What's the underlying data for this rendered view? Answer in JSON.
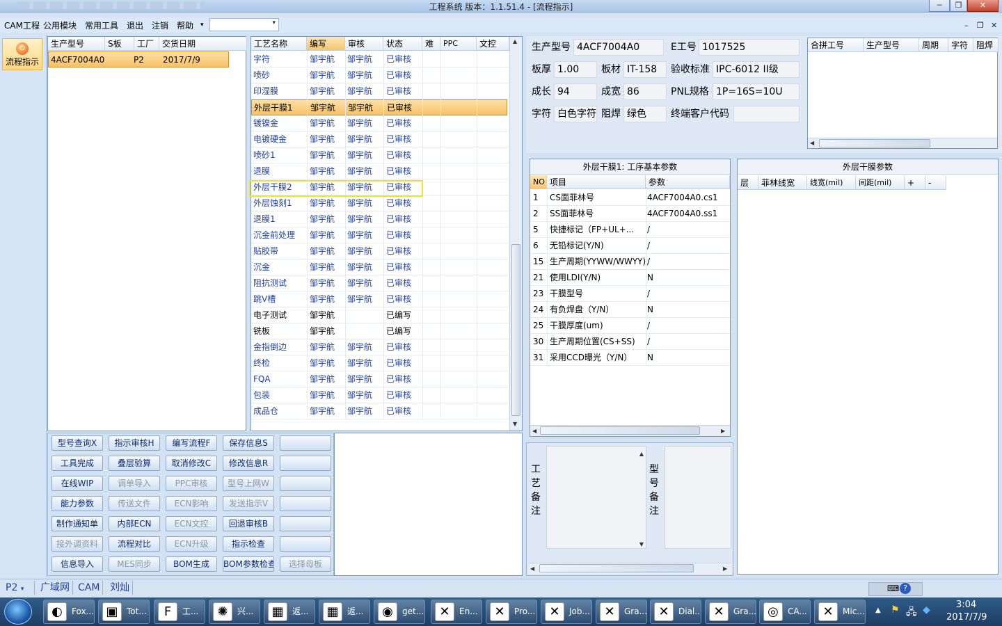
{
  "window": {
    "title": "工程系统   版本：1.1.51.4 - [流程指示]"
  },
  "menu": {
    "items": [
      "CAM工程",
      "公用模块",
      "常用工具",
      "退出",
      "注销",
      "帮助"
    ],
    "help_arrow": "▾"
  },
  "nav": {
    "flow_label": "流程指示"
  },
  "orders": {
    "headers": [
      "生产型号",
      "S板",
      "工厂",
      "交货日期"
    ],
    "rows": [
      [
        "4ACF7004A0",
        "",
        "P2",
        "2017/7/9"
      ]
    ]
  },
  "process": {
    "headers": [
      "工艺名称",
      "编写",
      "审核",
      "状态",
      "难",
      "PPC",
      "文控"
    ],
    "rows": [
      [
        "字符",
        "邹宇航",
        "邹宇航",
        "已审核"
      ],
      [
        "喷砂",
        "邹宇航",
        "邹宇航",
        "已审核"
      ],
      [
        "印湿膜",
        "邹宇航",
        "邹宇航",
        "已审核"
      ],
      [
        "外层干膜1",
        "邹宇航",
        "邹宇航",
        "已审核"
      ],
      [
        "镀镍金",
        "邹宇航",
        "邹宇航",
        "已审核"
      ],
      [
        "电镀硬金",
        "邹宇航",
        "邹宇航",
        "已审核"
      ],
      [
        "喷砂1",
        "邹宇航",
        "邹宇航",
        "已审核"
      ],
      [
        "退膜",
        "邹宇航",
        "邹宇航",
        "已审核"
      ],
      [
        "外层干膜2",
        "邹宇航",
        "邹宇航",
        "已审核"
      ],
      [
        "外层蚀刻1",
        "邹宇航",
        "邹宇航",
        "已审核"
      ],
      [
        "退膜1",
        "邹宇航",
        "邹宇航",
        "已审核"
      ],
      [
        "沉金前处理",
        "邹宇航",
        "邹宇航",
        "已审核"
      ],
      [
        "贴胶带",
        "邹宇航",
        "邹宇航",
        "已审核"
      ],
      [
        "沉金",
        "邹宇航",
        "邹宇航",
        "已审核"
      ],
      [
        "阻抗测试",
        "邹宇航",
        "邹宇航",
        "已审核"
      ],
      [
        "跳V槽",
        "邹宇航",
        "邹宇航",
        "已审核"
      ],
      [
        "电子测试",
        "邹宇航",
        "",
        "已编写"
      ],
      [
        "铣板",
        "邹宇航",
        "",
        "已编写"
      ],
      [
        "金指倒边",
        "邹宇航",
        "邹宇航",
        "已审核"
      ],
      [
        "终检",
        "邹宇航",
        "邹宇航",
        "已审核"
      ],
      [
        "FQA",
        "邹宇航",
        "邹宇航",
        "已审核"
      ],
      [
        "包装",
        "邹宇航",
        "邹宇航",
        "已审核"
      ],
      [
        "成品仓",
        "邹宇航",
        "邹宇航",
        "已审核"
      ]
    ]
  },
  "buttons": [
    [
      "型号查询X",
      "指示审核H",
      "编写流程F",
      "保存信息S",
      ""
    ],
    [
      "工具完成",
      "叠层验算",
      "取消修改C",
      "修改信息R",
      ""
    ],
    [
      "在线WIP",
      "调单导入",
      "PPC审核",
      "型号上网W",
      ""
    ],
    [
      "能力参数",
      "传送文件",
      "ECN影响",
      "发送指示V",
      ""
    ],
    [
      "制作通知单",
      "内部ECN",
      "ECN文控",
      "回退审核B",
      ""
    ],
    [
      "接外调资料",
      "流程对比",
      "ECN升级",
      "指示检查",
      ""
    ],
    [
      "信息导入",
      "MES同步",
      "BOM生成",
      "BOM参数检查",
      "选择母板"
    ]
  ],
  "info": {
    "model_label": "生产型号",
    "model": "4ACF7004A0",
    "e_label": "E工号",
    "e_no": "1017525",
    "thick_label": "板厚",
    "thick": "1.00",
    "mat_label": "板材",
    "mat": "IT-158",
    "std_label": "验收标准",
    "std": "IPC-6012 II级",
    "grow_label": "成长",
    "grow": "94",
    "width_label": "成宽",
    "width": "86",
    "pnl_label": "PNL规格",
    "pnl": "1P=16S=10U",
    "char_label": "字符",
    "char": "白色字符",
    "mask_label": "阻焊",
    "mask": "绿色",
    "cust_label": "终端客户代码",
    "cust": ""
  },
  "merge": {
    "headers": [
      "合拼工号",
      "生产型号",
      "周期",
      "字符",
      "阻焊"
    ]
  },
  "params": {
    "title": "外层干膜1: 工序基本参数",
    "headers": [
      "NO",
      "项目",
      "参数"
    ],
    "rows": [
      [
        "1",
        "CS面菲林号",
        "4ACF7004A0.cs1"
      ],
      [
        "2",
        "SS面菲林号",
        "4ACF7004A0.ss1"
      ],
      [
        "5",
        "快捷标记（FP+UL+...",
        "/"
      ],
      [
        "6",
        "无铅标记(Y/N)",
        "/"
      ],
      [
        "15",
        "生产周期(YYWW/WWYY)",
        "/"
      ],
      [
        "21",
        "使用LDI(Y/N)",
        "N"
      ],
      [
        "23",
        "干膜型号",
        "/"
      ],
      [
        "24",
        "有负焊盘（Y/N）",
        "N"
      ],
      [
        "25",
        "干膜厚度(um)",
        "/"
      ],
      [
        "30",
        "生产周期位置(CS+SS)",
        "/"
      ],
      [
        "31",
        "采用CCD曝光（Y/N）",
        "N"
      ]
    ]
  },
  "film": {
    "title": "外层干膜参数",
    "headers": [
      "层",
      "菲林线宽",
      "线宽(mil)",
      "间距(mil)",
      "+",
      "-"
    ]
  },
  "remarks": {
    "process_label": "工艺备注",
    "model_label": "型号备注"
  },
  "status": {
    "plant": "P2",
    "tabs": [
      "广域网",
      "CAM",
      "刘灿"
    ]
  },
  "taskbar": {
    "items": [
      "Fox...",
      "Tot...",
      "工...",
      "兴...",
      "返...",
      "返...",
      "get...",
      "En...",
      "Pro...",
      "Job...",
      "Gra...",
      "Dial...",
      "Gra...",
      "CA...",
      "Mic..."
    ],
    "time": "3:04",
    "date": "2017/7/9"
  }
}
